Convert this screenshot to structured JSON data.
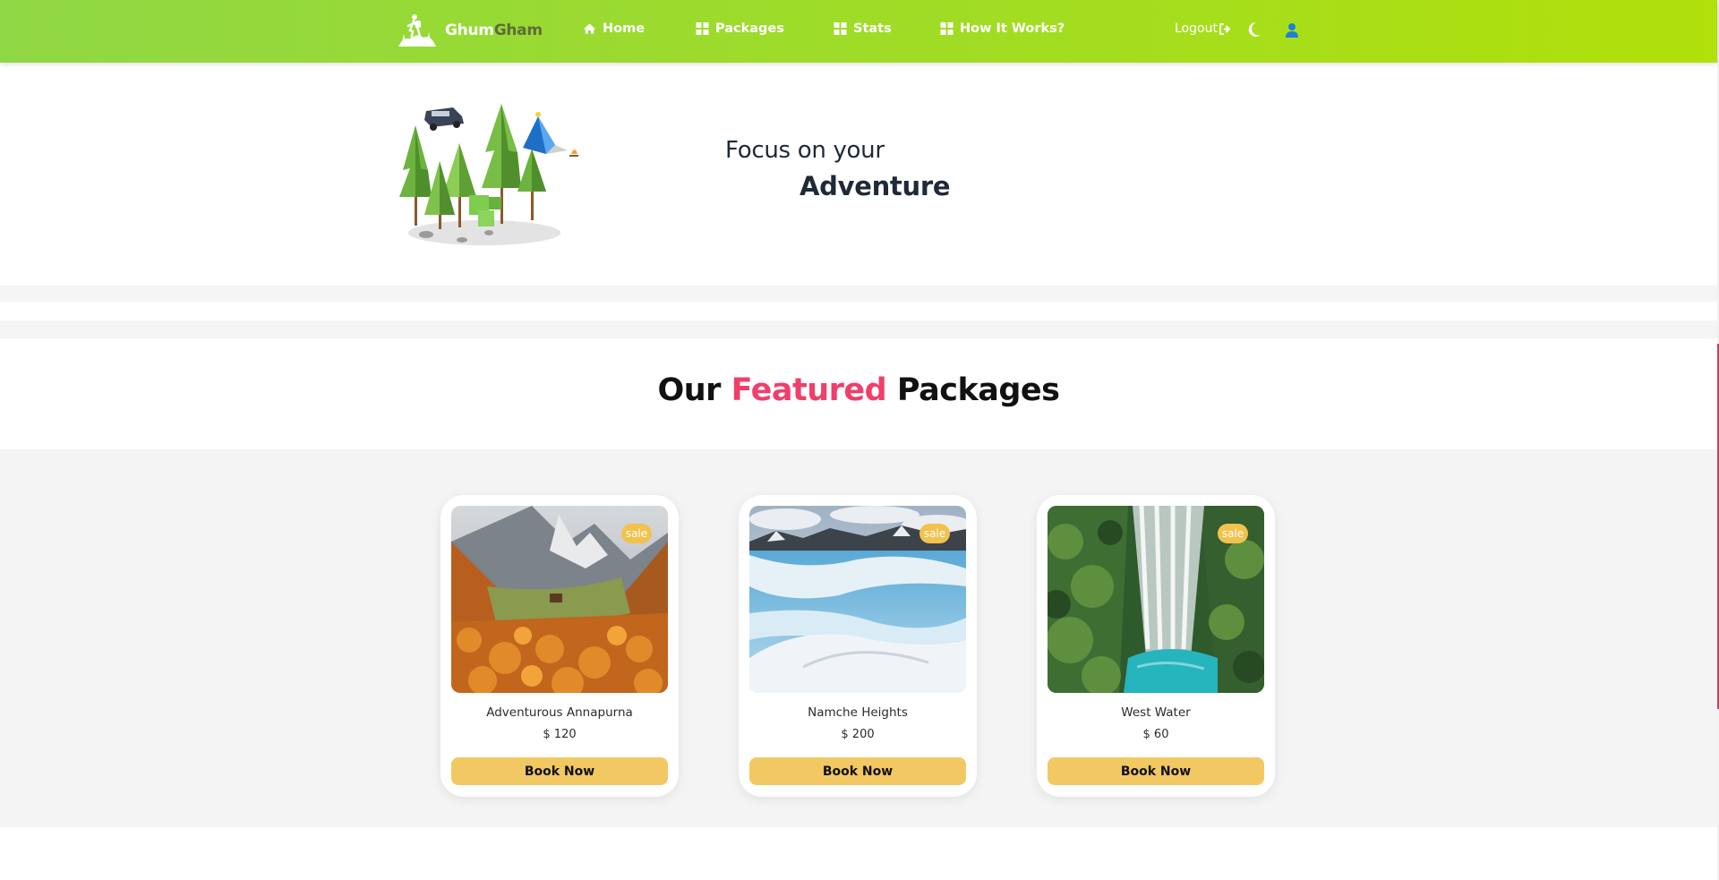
{
  "nav": {
    "brand_part1": "Ghum",
    "brand_part2": "Gham",
    "links": [
      {
        "label": "Home",
        "icon": "home-icon"
      },
      {
        "label": "Packages",
        "icon": "grid-icon"
      },
      {
        "label": "Stats",
        "icon": "grid-icon"
      },
      {
        "label": "How It Works?",
        "icon": "grid-icon"
      }
    ],
    "logout_label": "Logout",
    "icons": [
      "logout-icon",
      "moon-icon",
      "user-icon"
    ]
  },
  "hero": {
    "line1": "Focus on your",
    "line2": "Adventure"
  },
  "featured": {
    "heading_part1": "Our",
    "heading_accent": "Featured",
    "heading_part3": "Packages",
    "packages": [
      {
        "name": "Adventurous Annapurna",
        "price": "$ 120",
        "badge": "sale",
        "button": "Book Now"
      },
      {
        "name": "Namche Heights",
        "price": "$ 200",
        "badge": "sale",
        "button": "Book Now"
      },
      {
        "name": "West Water",
        "price": "$ 60",
        "badge": "sale",
        "button": "Book Now"
      }
    ]
  },
  "colors": {
    "nav_gradient_start": "#8fd744",
    "nav_gradient_end": "#b1e00a",
    "accent": "#ef3f6b",
    "button": "#f2c863",
    "badge": "#f2c24d",
    "user_icon": "#1e7fd8"
  }
}
